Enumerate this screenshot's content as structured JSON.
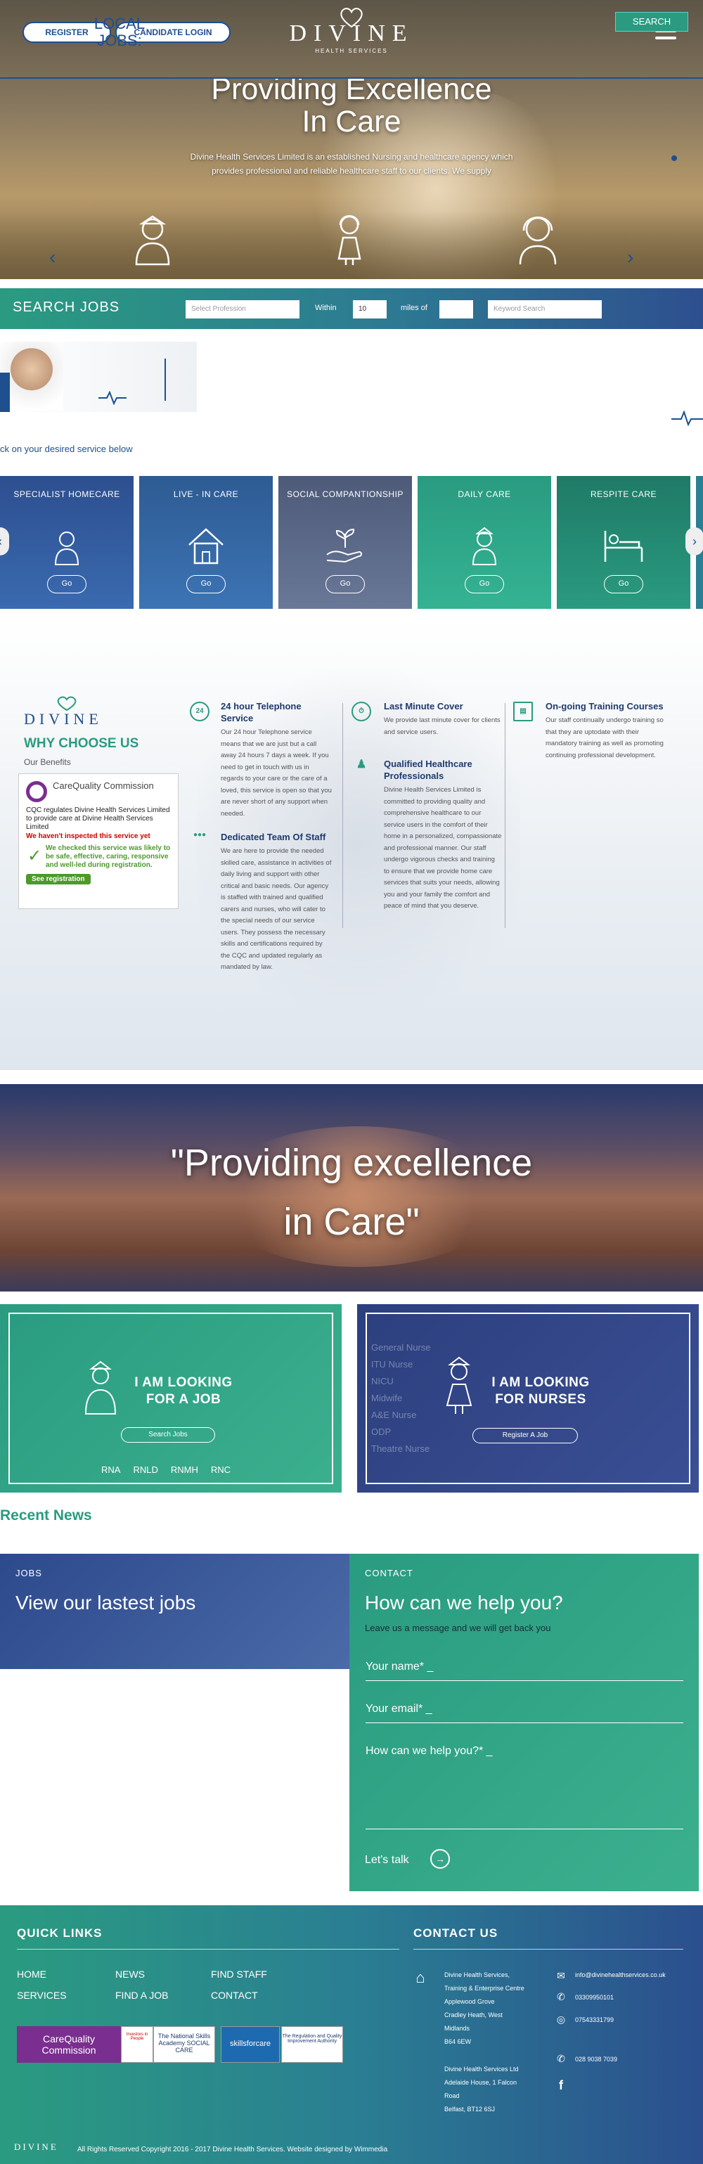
{
  "hero": {
    "register": "REGISTER",
    "candidate_login": "CANDIDATE LOGIN",
    "logo_word": "DIVINE",
    "logo_sub": "HEALTH SERVICES",
    "title_line1": "Providing Excellence",
    "title_line2": "In Care",
    "text": "Divine Health Services Limited is an established Nursing and healthcare agency which provides professional and reliable healthcare staff to our clients. We supply",
    "icons": [
      "nurse-icon",
      "carer-icon",
      "support-headset-icon"
    ]
  },
  "search": {
    "label": "SEARCH JOBS",
    "profession_placeholder": "Select Profession",
    "within": "Within",
    "miles_value": "10",
    "miles_of": "miles of",
    "keyword_placeholder": "Keyword Search",
    "button": "SEARCH"
  },
  "local": {
    "title": "LOCAL JOBS:",
    "hint": "ck on your desired service below"
  },
  "services": [
    {
      "name": "SPECIALIST HOMECARE",
      "icon": "nurse-icon",
      "go": "Go",
      "color": "#2d4f8f"
    },
    {
      "name": "LIVE - IN CARE",
      "icon": "house-icon",
      "go": "Go",
      "color": "#2e5b93"
    },
    {
      "name": "SOCIAL COMPANTIONSHIP",
      "icon": "hand-plant-icon",
      "go": "Go",
      "color": "#4d5a78"
    },
    {
      "name": "DAILY CARE",
      "icon": "nurse-icon",
      "go": "Go",
      "color": "#2a9b80"
    },
    {
      "name": "RESPITE CARE",
      "icon": "bed-icon",
      "go": "Go",
      "color": "#1f7a66"
    }
  ],
  "why": {
    "logo": "DIVINE",
    "title": "WHY CHOOSE US",
    "sub": "Our Benefits",
    "cqc_head": "CareQuality Commission",
    "cqc_reg": "CQC regulates Divine Health Services Limited to provide care at Divine Health Services Limited",
    "cqc_warn": "We haven't inspected this service yet",
    "cqc_ok": "We checked this service was likely to be safe, effective, caring, responsive and well-led during registration.",
    "cqc_btn": "See registration",
    "benefits": [
      {
        "title": "24 hour Telephone Service",
        "text": "Our 24 hour Telephone service means that we are just but a call away 24 hours 7 days a week. If you need to get in touch with us in regards to your care or the care of a loved, this service is open so that you are never short of any support when needed."
      },
      {
        "title": "Dedicated Team Of Staff",
        "text": "We are here to provide the needed skilled care, assistance in activities of daily living and support with other critical and basic needs. Our agency is staffed with trained and qualified carers and nurses, who will cater to the special needs of our service users. They possess the necessary skills and certifications required by the CQC and updated regularly as mandated by law."
      },
      {
        "title": "Last Minute Cover",
        "text": "We provide last minute cover for clients and service users."
      },
      {
        "title": "Qualified Healthcare Professionals",
        "text": "Divine Health Services Limited is committed to providing quality and comprehensive healthcare to our service users in the comfort of their home in a personalized, compassionate and professional manner. Our staff undergo vigorous checks and training to ensure that we provide home care services that suits your needs, allowing you and your family the comfort and peace of mind that you deserve."
      },
      {
        "title": "On-going Training Courses",
        "text": "Our staff continually undergo training so that they are uptodate with their mandatory training as well as promoting continuing professional development."
      }
    ]
  },
  "quote": {
    "line1": "\"Providing excellence",
    "line2": "in Care\""
  },
  "job_box": {
    "title_line1": "I AM LOOKING",
    "title_line2": "FOR A JOB",
    "button": "Search Jobs",
    "tags": [
      "RNA",
      "RNLD",
      "RNMH",
      "RNC"
    ]
  },
  "nurse_box": {
    "title_line1": "I AM LOOKING",
    "title_line2": "FOR NURSES",
    "button": "Register A Job",
    "roles": [
      "General Nurse",
      "ITU Nurse",
      "NICU",
      "Midwife",
      "A&E Nurse",
      "ODP",
      "Theatre Nurse"
    ]
  },
  "recent_news": "Recent News",
  "jobs_panel": {
    "cap": "JOBS",
    "heading": "View our lastest jobs"
  },
  "contact_panel": {
    "cap": "CONTACT",
    "heading": "How can we help you?",
    "sub": "Leave us a message and we will get back you",
    "name": "Your name* _",
    "email": "Your email* _",
    "message": "How can we help you?* _",
    "talk": "Let's talk"
  },
  "footer": {
    "quick_links": "QUICK LINKS",
    "contact_us": "CONTACT US",
    "links": [
      "HOME",
      "NEWS",
      "FIND STAFF",
      "SERVICES",
      "FIND A JOB",
      "CONTACT"
    ],
    "address1": [
      "Divine Health Services,",
      "Training & Enterprise Centre",
      "Applewood Grove",
      "Cradley Heath, West",
      "Midlands",
      "B64 6EW"
    ],
    "address2": [
      "Divine Health Services Ltd",
      "Adelaide House, 1 Falcon",
      "Road",
      "Belfast, BT12 6SJ"
    ],
    "email": "info@divinehealthservices.co.uk",
    "phone1": "03309950101",
    "phone2": "07543331799",
    "phone3": "028 9038 7039",
    "badges": [
      "CareQuality Commission",
      "Investors in People",
      "The National Skills Academy SOCIAL CARE",
      "skillsforcare",
      "The Regulation and Quality Improvement Authority"
    ],
    "copyright": "All Rights Reserved Copyright 2016 - 2017 Divine Health Services. Website designed by Wimmedia",
    "logo": "DIVINE"
  }
}
